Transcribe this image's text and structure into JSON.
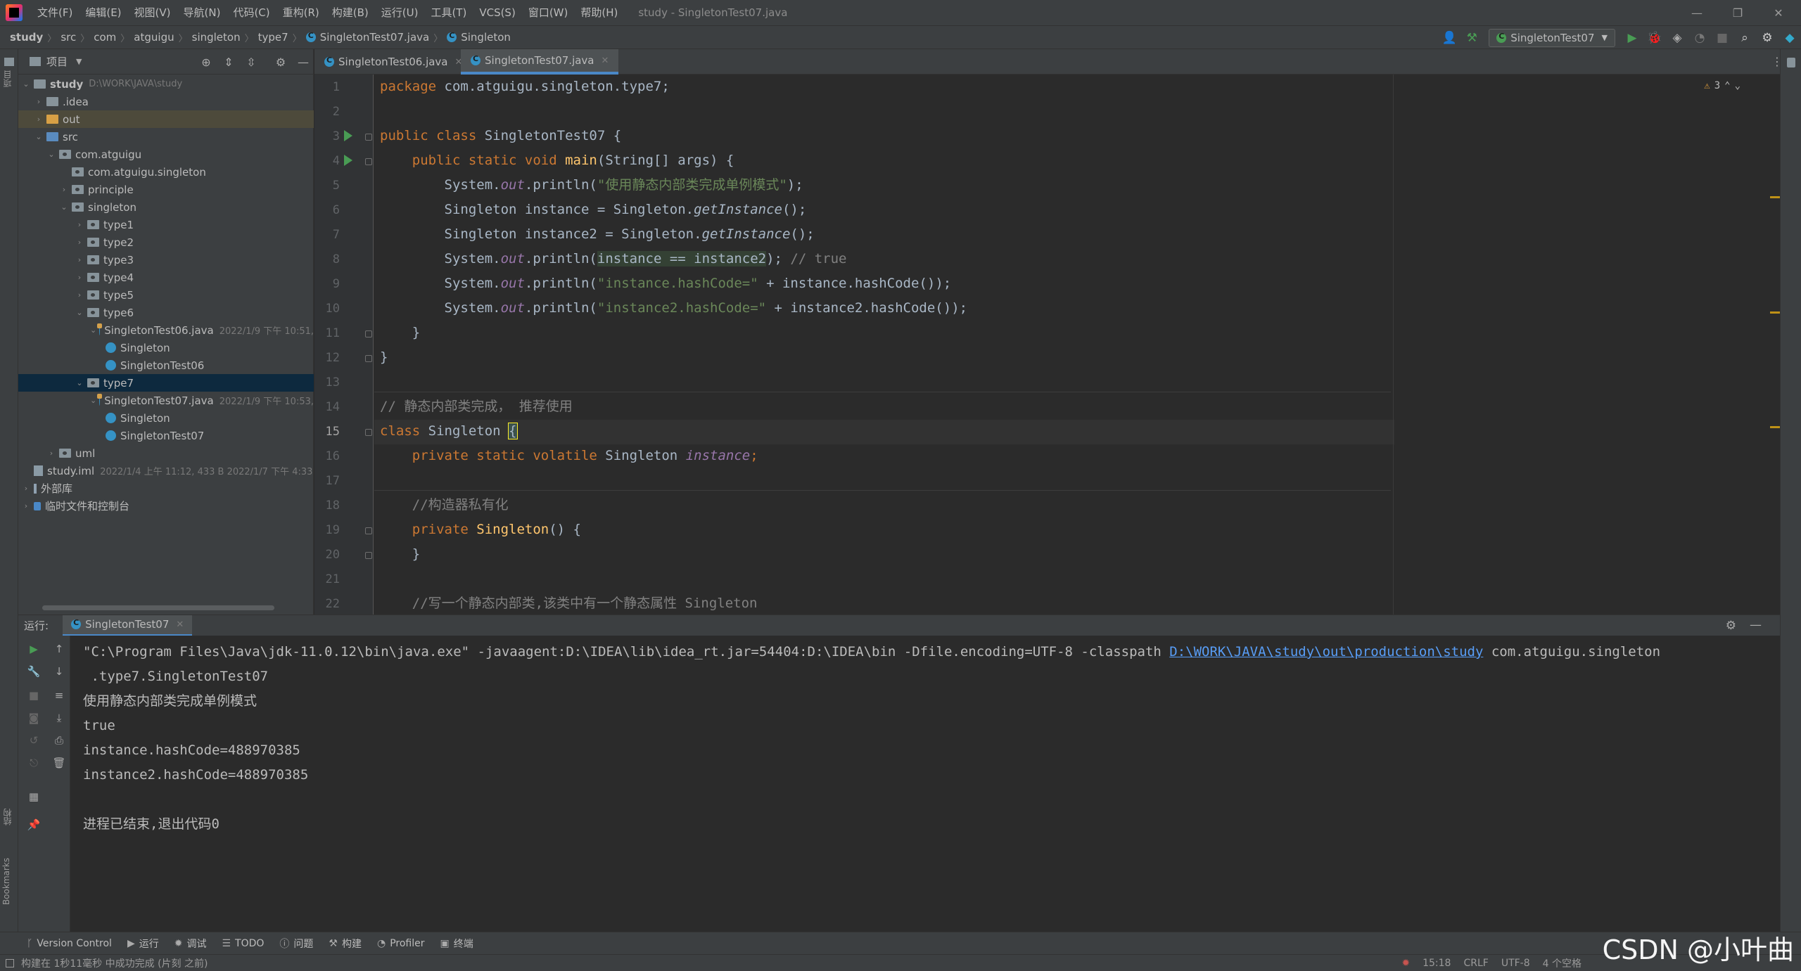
{
  "menubar": {
    "items": [
      "文件(F)",
      "编辑(E)",
      "视图(V)",
      "导航(N)",
      "代码(C)",
      "重构(R)",
      "构建(B)",
      "运行(U)",
      "工具(T)",
      "VCS(S)",
      "窗口(W)",
      "帮助(H)"
    ],
    "title": "study - SingletonTest07.java"
  },
  "breadcrumb": [
    "study",
    "src",
    "com",
    "atguigu",
    "singleton",
    "type7",
    "SingletonTest07.java",
    "Singleton"
  ],
  "run_config": "SingletonTest07",
  "left_stripe": {
    "project": "项目",
    "structure": "结构",
    "bookmarks": "Bookmarks"
  },
  "project": {
    "header": "项目",
    "tree": [
      {
        "label": "study",
        "meta": "D:\\WORK\\JAVA\\study",
        "bold": true
      },
      {
        "label": ".idea"
      },
      {
        "label": "out"
      },
      {
        "label": "src"
      },
      {
        "label": "com.atguigu"
      },
      {
        "label": "com.atguigu.singleton"
      },
      {
        "label": "principle"
      },
      {
        "label": "singleton"
      },
      {
        "label": "type1"
      },
      {
        "label": "type2"
      },
      {
        "label": "type3"
      },
      {
        "label": "type4"
      },
      {
        "label": "type5"
      },
      {
        "label": "type6"
      },
      {
        "label": "SingletonTest06.java",
        "meta": "2022/1/9 下午 10:51,"
      },
      {
        "label": "Singleton"
      },
      {
        "label": "SingletonTest06"
      },
      {
        "label": "type7"
      },
      {
        "label": "SingletonTest07.java",
        "meta": "2022/1/9 下午 10:53,"
      },
      {
        "label": "Singleton"
      },
      {
        "label": "SingletonTest07"
      },
      {
        "label": "uml"
      },
      {
        "label": "study.iml",
        "meta": "2022/1/4 上午 11:12, 433 B 2022/1/7 下午 4:33"
      },
      {
        "label": "外部库"
      },
      {
        "label": "临时文件和控制台"
      }
    ]
  },
  "editor": {
    "tabs": [
      "SingletonTest06.java",
      "SingletonTest07.java"
    ],
    "warnings": "3",
    "line_numbers": [
      "1",
      "2",
      "3",
      "4",
      "5",
      "6",
      "7",
      "8",
      "9",
      "10",
      "11",
      "12",
      "13",
      "14",
      "15",
      "16",
      "17",
      "18",
      "19",
      "20",
      "21",
      "22"
    ],
    "code": {
      "l1_kw": "package",
      "l1_rest": " com.atguigu.singleton.type7;",
      "l3_kw": "public class",
      "l3_rest": " SingletonTest07 {",
      "l4_kw": "    public static void",
      "l4_fn": " main",
      "l4_rest": "(String[] args) {",
      "l5_a": "        System.",
      "l5_out": "out",
      "l5_b": ".println(",
      "l5_str": "\"使用静态内部类完成单例模式\"",
      "l5_c": ");",
      "l6_a": "        Singleton instance = Singleton.",
      "l6_it": "getInstance",
      "l6_b": "();",
      "l7_a": "        Singleton instance2 = Singleton.",
      "l7_it": "getInstance",
      "l7_b": "();",
      "l8_a": "        System.",
      "l8_out": "out",
      "l8_b": ".println(",
      "l8_hl": "instance == instance2",
      "l8_c": "); ",
      "l8_cmt": "// true",
      "l9_a": "        System.",
      "l9_out": "out",
      "l9_b": ".println(",
      "l9_str": "\"instance.hashCode=\"",
      "l9_c": " + instance.hashCode());",
      "l10_a": "        System.",
      "l10_out": "out",
      "l10_b": ".println(",
      "l10_str": "\"instance2.hashCode=\"",
      "l10_c": " + instance2.hashCode());",
      "l11": "    }",
      "l12": "}",
      "l14_cmt": "// 静态内部类完成， 推荐使用",
      "l15_kw": "class",
      "l15_rest": " Singleton ",
      "l15_brace": "{",
      "l16_kw": "    private static volatile",
      "l16_rest": " Singleton ",
      "l16_fld": "instance",
      "l16_end": ";",
      "l18_cmt": "    //构造器私有化",
      "l19_kw": "    private",
      "l19_fn": " Singleton",
      "l19_rest": "() {",
      "l20": "    }",
      "l22_cmt": "    //写一个静态内部类,该类中有一个静态属性 Singleton"
    }
  },
  "run": {
    "label": "运行:",
    "tab": "SingletonTest07",
    "cmd_a": "\"C:\\Program Files\\Java\\jdk-11.0.12\\bin\\java.exe\" -javaagent:D:\\IDEA\\lib\\idea_rt.jar=54404:D:\\IDEA\\bin -Dfile.encoding=UTF-8 -classpath ",
    "cmd_link": "D:\\WORK\\JAVA\\study\\out\\production\\study",
    "cmd_b": " com.atguigu.singleton",
    "cmd_c": " .type7.SingletonTest07",
    "out1": "使用静态内部类完成单例模式",
    "out2": "true",
    "out3": "instance.hashCode=488970385",
    "out4": "instance2.hashCode=488970385",
    "exit": "进程已结束,退出代码0"
  },
  "bottombar": [
    "Version Control",
    "运行",
    "调试",
    "TODO",
    "问题",
    "构建",
    "Profiler",
    "终端"
  ],
  "status": {
    "left": "构建在 1秒11毫秒 中成功完成 (片刻 之前)",
    "pos": "15:18",
    "eol": "CRLF",
    "enc": "UTF-8",
    "indent": "4 个空格"
  },
  "watermark": "CSDN @小叶曲",
  "colors": {
    "keyword": "#cc7832",
    "string": "#6a8759",
    "field": "#9876aa",
    "function": "#ffc66d",
    "comment": "#808080",
    "accent": "#4a88c7"
  }
}
